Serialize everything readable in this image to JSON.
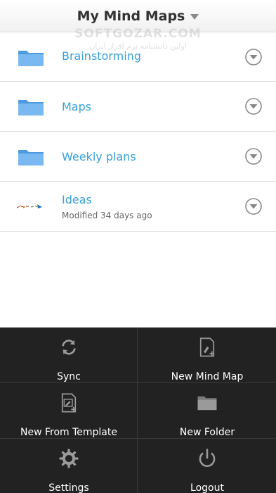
{
  "header": {
    "title": "My Mind Maps"
  },
  "watermark": {
    "line1": "SOFTGOZAR.COM",
    "line2": "اولین دانشنامه نرم افزار ایران"
  },
  "items": [
    {
      "label": "Brainstorming",
      "subtitle": "",
      "type": "folder"
    },
    {
      "label": "Maps",
      "subtitle": "",
      "type": "folder"
    },
    {
      "label": "Weekly plans",
      "subtitle": "",
      "type": "folder"
    },
    {
      "label": "Ideas",
      "subtitle": "Modified 34 days ago",
      "type": "map"
    }
  ],
  "menu": {
    "sync": "Sync",
    "new_map": "New Mind Map",
    "new_template": "New From Template",
    "new_folder": "New Folder",
    "settings": "Settings",
    "logout": "Logout"
  },
  "colors": {
    "link": "#3aa0d8",
    "folder": "#5da8e8",
    "panel_bg": "#222222"
  }
}
